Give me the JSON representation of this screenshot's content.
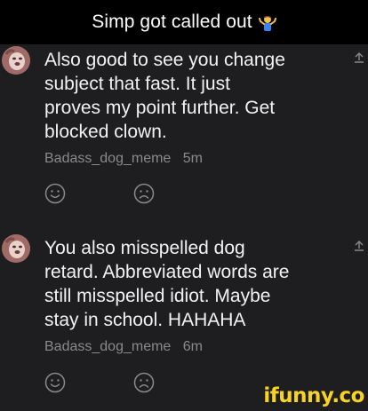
{
  "header": {
    "title": "Simp got called out",
    "emoji_icon": "person-shrugging-emoji"
  },
  "comments": [
    {
      "text": "Also good to see you change\nsubject that fast. It just\nproves my point further. Get\nblocked clown.",
      "author": "Badass_dog_meme",
      "time": "5m",
      "avatar_icon": "dog-avatar",
      "reply_icon": "reply-icon",
      "reactions": [
        "smile-icon",
        "frown-icon"
      ]
    },
    {
      "text": "You also misspelled dog\nretard. Abbreviated words are\nstill misspelled idiot. Maybe\nstay in school. HAHAHA",
      "author": "Badass_dog_meme",
      "time": "6m",
      "avatar_icon": "dog-avatar",
      "reply_icon": "reply-icon",
      "reactions": [
        "smile-icon",
        "frown-icon"
      ]
    }
  ],
  "watermark": "ifunny.co",
  "colors": {
    "background": "#1e1e20",
    "header_background": "#000000",
    "text": "#f2f2f2",
    "meta_text": "#8a8a8e",
    "watermark": "#f7d325"
  }
}
